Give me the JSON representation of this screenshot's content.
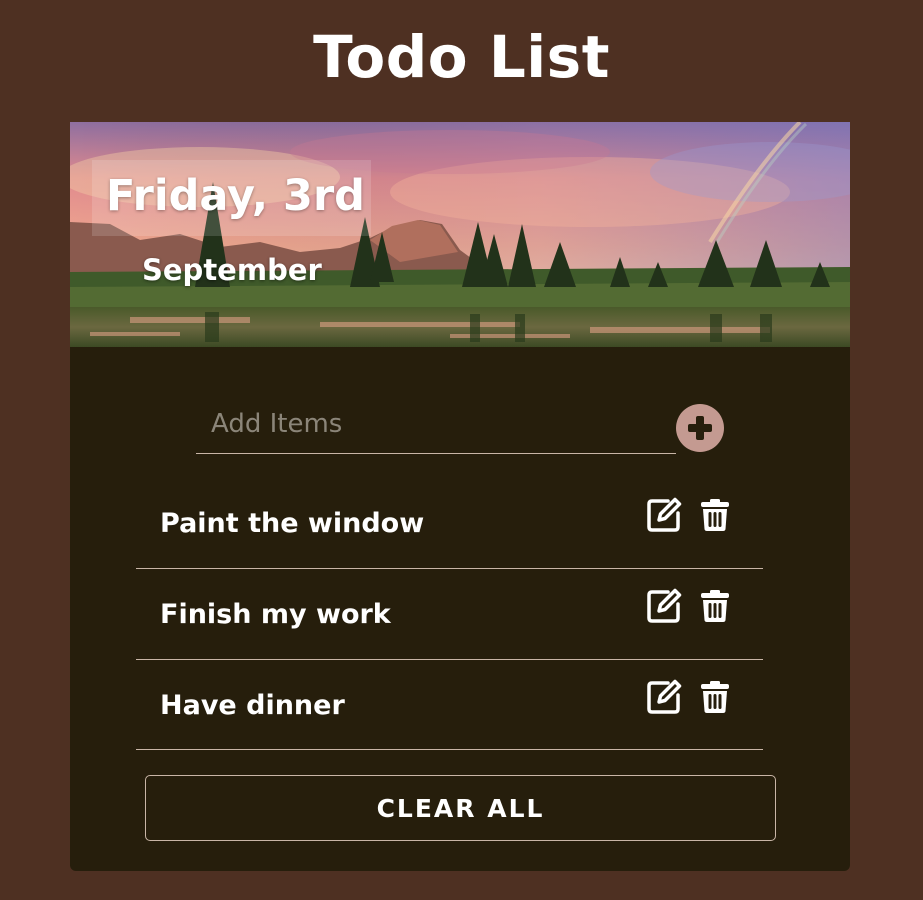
{
  "app": {
    "title": "Todo List"
  },
  "banner": {
    "day": "Friday, 3rd",
    "month": "September"
  },
  "add": {
    "placeholder": "Add Items",
    "value": "",
    "button_icon": "plus-circle-icon"
  },
  "todos": [
    {
      "text": "Paint the window"
    },
    {
      "text": "Finish my work"
    },
    {
      "text": "Have dinner"
    }
  ],
  "actions": {
    "clear_all_label": "CLEAR ALL"
  },
  "colors": {
    "page_background": "#4e3022",
    "card_background": "#261e0c",
    "accent_button": "#c49a91",
    "divider": "#c9b6a7",
    "text": "#ffffff"
  }
}
